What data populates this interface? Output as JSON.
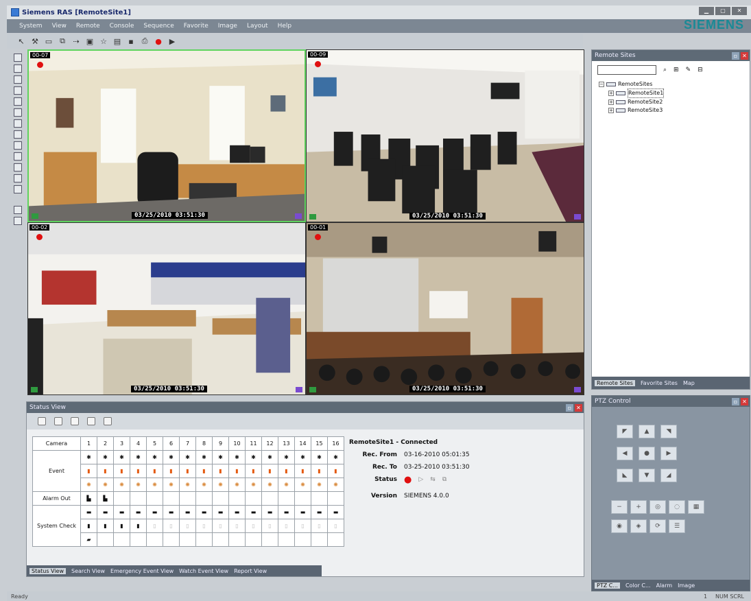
{
  "window": {
    "title": "Siemens RAS [RemoteSite1]",
    "brand": "SIEMENS"
  },
  "menu": [
    "System",
    "View",
    "Remote",
    "Console",
    "Sequence",
    "Favorite",
    "Image",
    "Layout",
    "Help"
  ],
  "cameras": [
    {
      "label": "00-07",
      "timestamp": "03/25/2010 03:51:30"
    },
    {
      "label": "00-09",
      "timestamp": "03/25/2010 03:51:30"
    },
    {
      "label": "00-02",
      "timestamp": "03/25/2010 03:51:30"
    },
    {
      "label": "00-01",
      "timestamp": "03/25/2010 03:51:30"
    }
  ],
  "status_view": {
    "title": "Status View",
    "table": {
      "camera_label": "Camera",
      "numbers": [
        "1",
        "2",
        "3",
        "4",
        "5",
        "6",
        "7",
        "8",
        "9",
        "10",
        "11",
        "12",
        "13",
        "14",
        "15",
        "16"
      ],
      "rows": [
        "Event",
        "Alarm Out",
        "System Check"
      ]
    },
    "info": {
      "site": "RemoteSite1 - Connected",
      "rec_from_label": "Rec. From",
      "rec_from": "03-16-2010 05:01:35",
      "rec_to_label": "Rec. To",
      "rec_to": "03-25-2010 03:51:30",
      "status_label": "Status",
      "version_label": "Version",
      "version": "SIEMENS 4.0.0"
    },
    "tabs": [
      "Status View",
      "Search View",
      "Emergency Event View",
      "Watch Event View",
      "Report View"
    ]
  },
  "remote_sites": {
    "title": "Remote Sites",
    "root": "RemoteSites",
    "sites": [
      "RemoteSite1",
      "RemoteSite2",
      "RemoteSite3"
    ],
    "tabs": [
      "Remote Sites",
      "Favorite Sites",
      "Map"
    ]
  },
  "ptz": {
    "title": "PTZ Control",
    "tabs": [
      "PTZ C...",
      "Color C...",
      "Alarm",
      "Image"
    ]
  },
  "statusbar": {
    "text": "Ready",
    "num": "1",
    "caps": "NUM SCRL"
  },
  "colors": {
    "record": "#e01010",
    "accent": "#1a8a96",
    "selected": "#5fd35f"
  }
}
